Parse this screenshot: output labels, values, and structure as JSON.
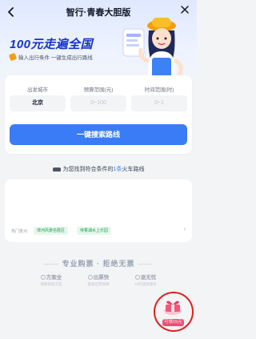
{
  "header": {
    "back_icon": "chevron-left-icon",
    "title": "智行·青春大胆版",
    "close_icon": "close-icon"
  },
  "hero": {
    "headline": "100元走遍全国",
    "subline": "输入出行条件 一键生成出行路线"
  },
  "form": {
    "labels": [
      "出发城市",
      "预算范围(元)",
      "时间范围(时)"
    ],
    "origin_value": "北京",
    "budget_placeholder": "0~100",
    "days_placeholder": "0~1",
    "search_button": "一键搜索路线"
  },
  "result": {
    "prefix": "为您找到符合条件的",
    "count": "1条",
    "suffix": "火车路线"
  },
  "routes": {
    "hot_label": "热门景点:",
    "tags": [
      "滦河风景名胜区",
      "侍香湖水上乐园"
    ]
  },
  "slogan": {
    "left_dash": "——",
    "text": "专业购票 · 拒绝无票",
    "right_dash": "——"
  },
  "features": [
    {
      "title": "方案全",
      "sub": "线路智能方案"
    },
    {
      "title": "出票快",
      "sub": "极速出票保障"
    },
    {
      "title": "退无忧",
      "sub": "24时退改服务"
    }
  ],
  "coupon": {
    "label": "可领15元"
  },
  "colors": {
    "accent": "#3a7cf6",
    "headline": "#1434c8",
    "ring": "#e11d1d"
  }
}
